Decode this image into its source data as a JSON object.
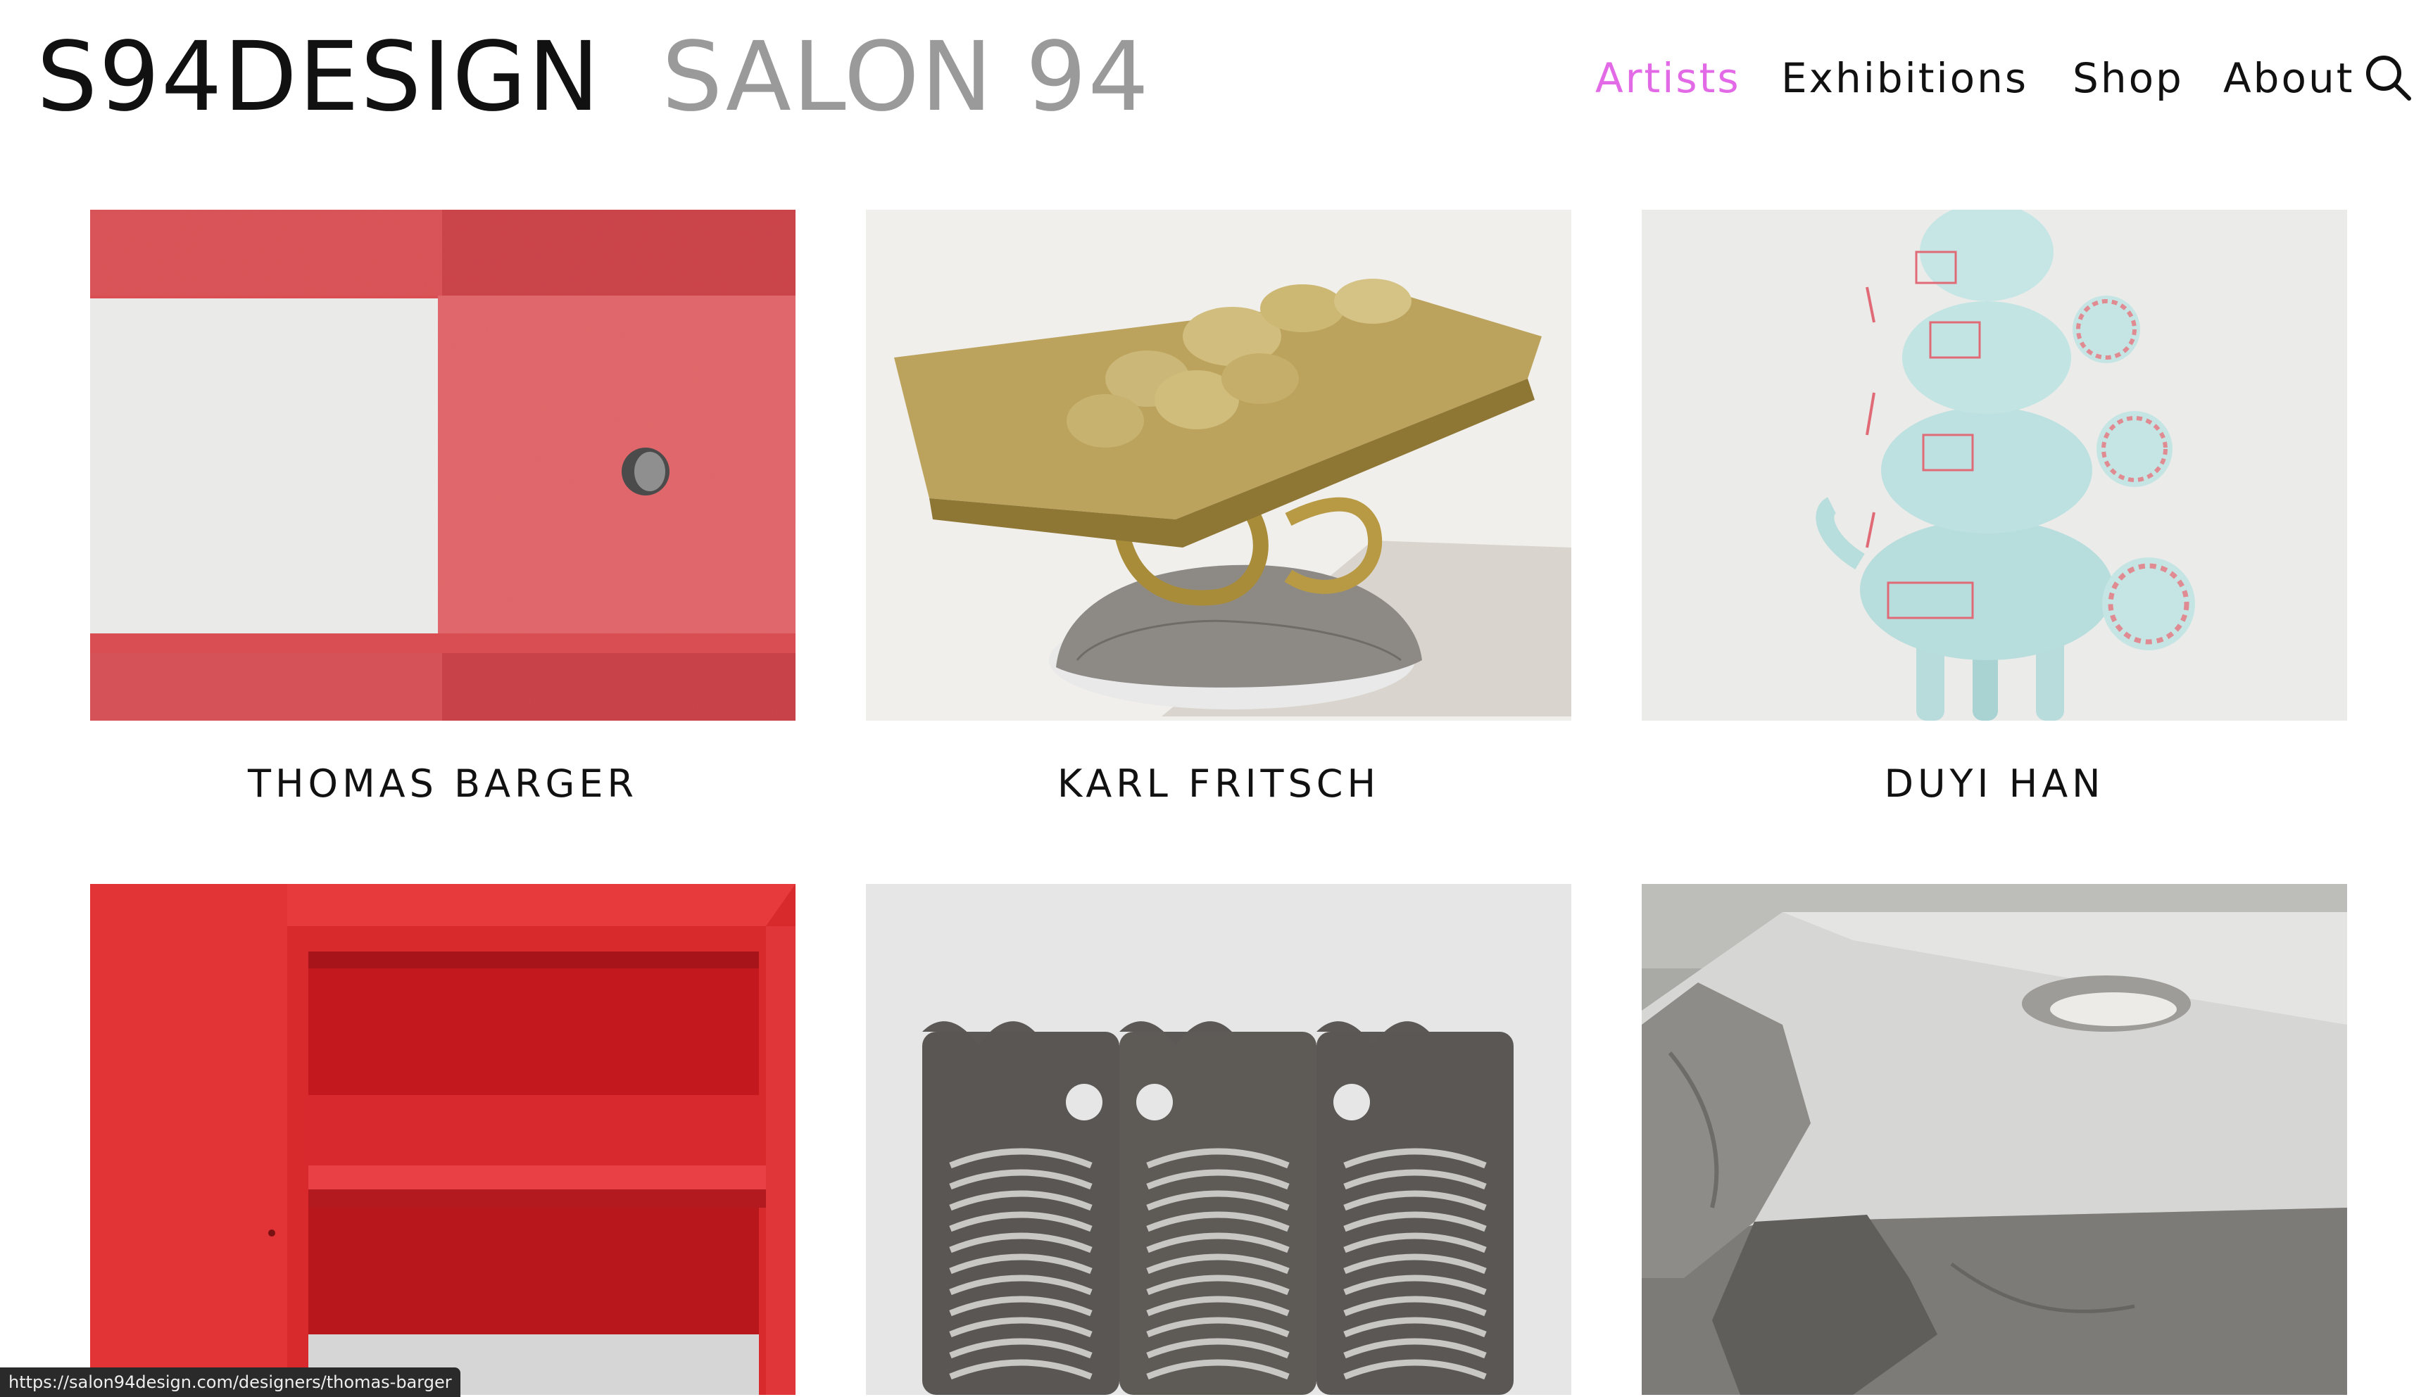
{
  "site": {
    "logo_primary": "S94DESIGN",
    "logo_secondary": "SALON 94"
  },
  "nav": {
    "items": [
      {
        "label": "Artists",
        "active": true
      },
      {
        "label": "Exhibitions",
        "active": false
      },
      {
        "label": "Shop",
        "active": false
      },
      {
        "label": "About",
        "active": false
      }
    ],
    "search_icon": "search-icon",
    "active_color": "#e36ae6"
  },
  "artists": [
    {
      "name": "THOMAS BARGER",
      "image": "red-panel-with-hole"
    },
    {
      "name": "KARL FRITSCH",
      "image": "gold-ring-sculpture"
    },
    {
      "name": "DUYI HAN",
      "image": "blue-ceramic-tower"
    },
    {
      "name": "",
      "image": "red-shelf-cabinet"
    },
    {
      "name": "",
      "image": "metal-grille-panels"
    },
    {
      "name": "",
      "image": "silver-cast-slab"
    }
  ],
  "status_url": "https://salon94design.com/designers/thomas-barger"
}
